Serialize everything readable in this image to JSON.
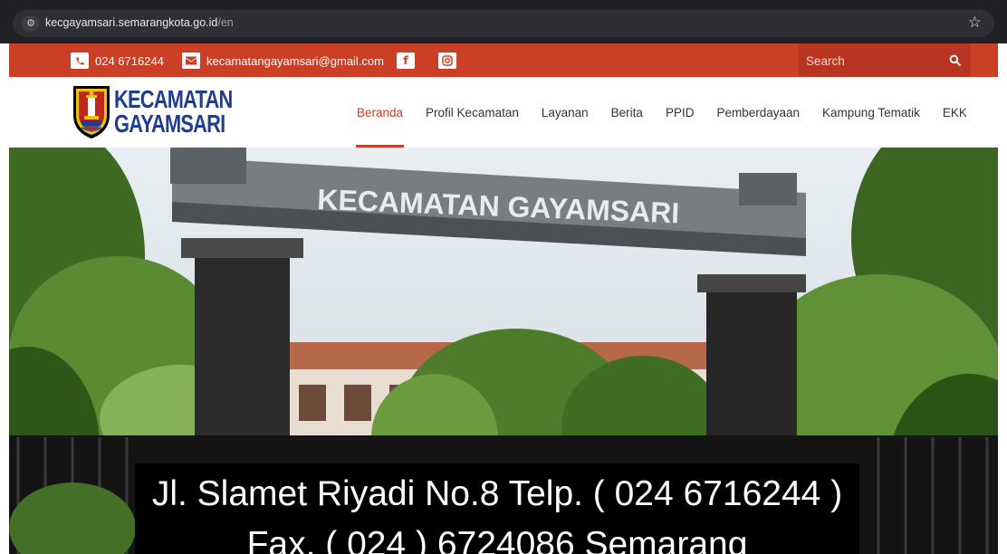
{
  "browser": {
    "url_host": "kecgayamsari.semarangkota.go.id",
    "url_path": "/en",
    "site_info_icon": "tune-icon",
    "bookmark_icon": "star-icon"
  },
  "top_bar": {
    "phone": "024 6716244",
    "email": "kecamatangayamsari@gmail.com",
    "search_placeholder": "Search",
    "social": [
      "facebook-icon",
      "instagram-icon"
    ],
    "accent_color": "#cb3f26"
  },
  "header": {
    "logo_line1": "KECAMATAN",
    "logo_line2": "GAYAMSARI",
    "nav": [
      {
        "label": "Beranda",
        "active": true
      },
      {
        "label": "Profil Kecamatan"
      },
      {
        "label": "Layanan"
      },
      {
        "label": "Berita"
      },
      {
        "label": "PPID"
      },
      {
        "label": "Pemberdayaan"
      },
      {
        "label": "Kampung Tematik"
      },
      {
        "label": "EKK"
      }
    ]
  },
  "hero": {
    "gate_text": "KECAMATAN GAYAMSARI",
    "caption_line1": "Jl. Slamet Riyadi No.8 Telp. ( 024 6716244 )",
    "caption_line2": "Fax. ( 024 ) 6724086 Semarang"
  }
}
